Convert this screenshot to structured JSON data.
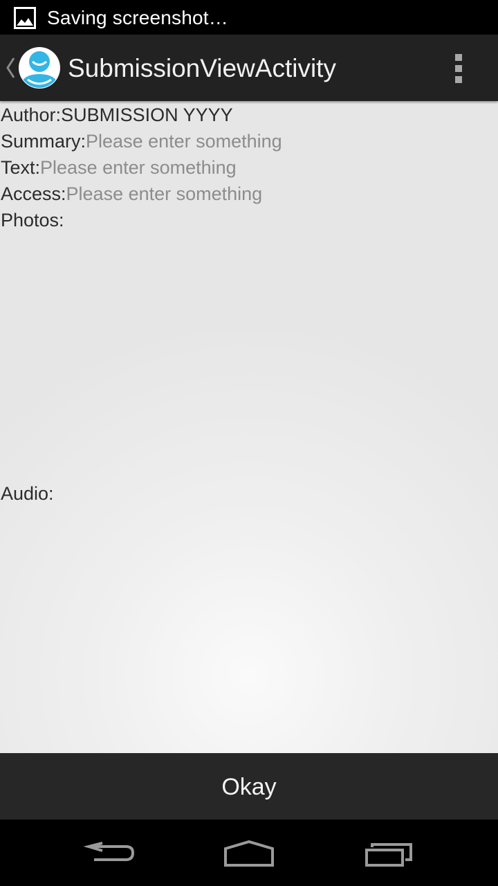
{
  "status_bar": {
    "icon": "image-icon",
    "notification_text": "Saving screenshot…"
  },
  "action_bar": {
    "up_icon": "chevron-left-icon",
    "app_icon": "user-avatar-icon",
    "title": "SubmissionViewActivity",
    "overflow_icon": "more-vertical-icon"
  },
  "fields": {
    "author": {
      "label": "Author:",
      "value": "SUBMISSION YYYY"
    },
    "summary": {
      "label": "Summary:",
      "placeholder": "Please enter something"
    },
    "text": {
      "label": "Text:",
      "placeholder": "Please enter something"
    },
    "access": {
      "label": "Access:",
      "placeholder": "Please enter something"
    },
    "photos": {
      "label": "Photos:"
    },
    "audio": {
      "label": "Audio:"
    }
  },
  "okay_button": {
    "label": "Okay"
  },
  "nav_bar": {
    "back_icon": "back-icon",
    "home_icon": "home-icon",
    "recents_icon": "recents-icon"
  },
  "colors": {
    "accent": "#33b5e5",
    "action_bar": "#222222",
    "hint_text": "#8c8c8c"
  }
}
